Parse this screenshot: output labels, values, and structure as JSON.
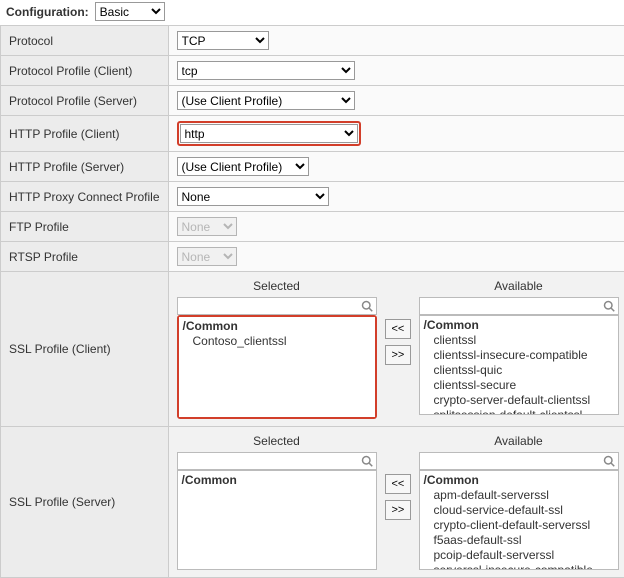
{
  "top": {
    "label": "Configuration:",
    "value": "Basic"
  },
  "rows": {
    "protocol": {
      "label": "Protocol",
      "value": "TCP"
    },
    "pp_client": {
      "label": "Protocol Profile (Client)",
      "value": "tcp"
    },
    "pp_server": {
      "label": "Protocol Profile (Server)",
      "value": "(Use Client Profile)"
    },
    "http_client": {
      "label": "HTTP Profile (Client)",
      "value": "http"
    },
    "http_server": {
      "label": "HTTP Profile (Server)",
      "value": "(Use Client Profile)"
    },
    "proxy_connect": {
      "label": "HTTP Proxy Connect Profile",
      "value": "None"
    },
    "ftp": {
      "label": "FTP Profile",
      "value": "None"
    },
    "rtsp": {
      "label": "RTSP Profile",
      "value": "None"
    }
  },
  "dual": {
    "selected_header": "Selected",
    "available_header": "Available",
    "move_left": "<<",
    "move_right": ">>"
  },
  "ssl_client": {
    "label": "SSL Profile (Client)",
    "selected_group": "/Common",
    "selected_items": [
      "Contoso_clientssl"
    ],
    "available_group": "/Common",
    "available_items": [
      "clientssl",
      "clientssl-insecure-compatible",
      "clientssl-quic",
      "clientssl-secure",
      "crypto-server-default-clientssl",
      "splitsession-default-clientssl"
    ]
  },
  "ssl_server": {
    "label": "SSL Profile (Server)",
    "selected_group": "/Common",
    "selected_items": [],
    "available_group": "/Common",
    "available_items": [
      "apm-default-serverssl",
      "cloud-service-default-ssl",
      "crypto-client-default-serverssl",
      "f5aas-default-ssl",
      "pcoip-default-serverssl",
      "serverssl-insecure-compatible"
    ]
  }
}
